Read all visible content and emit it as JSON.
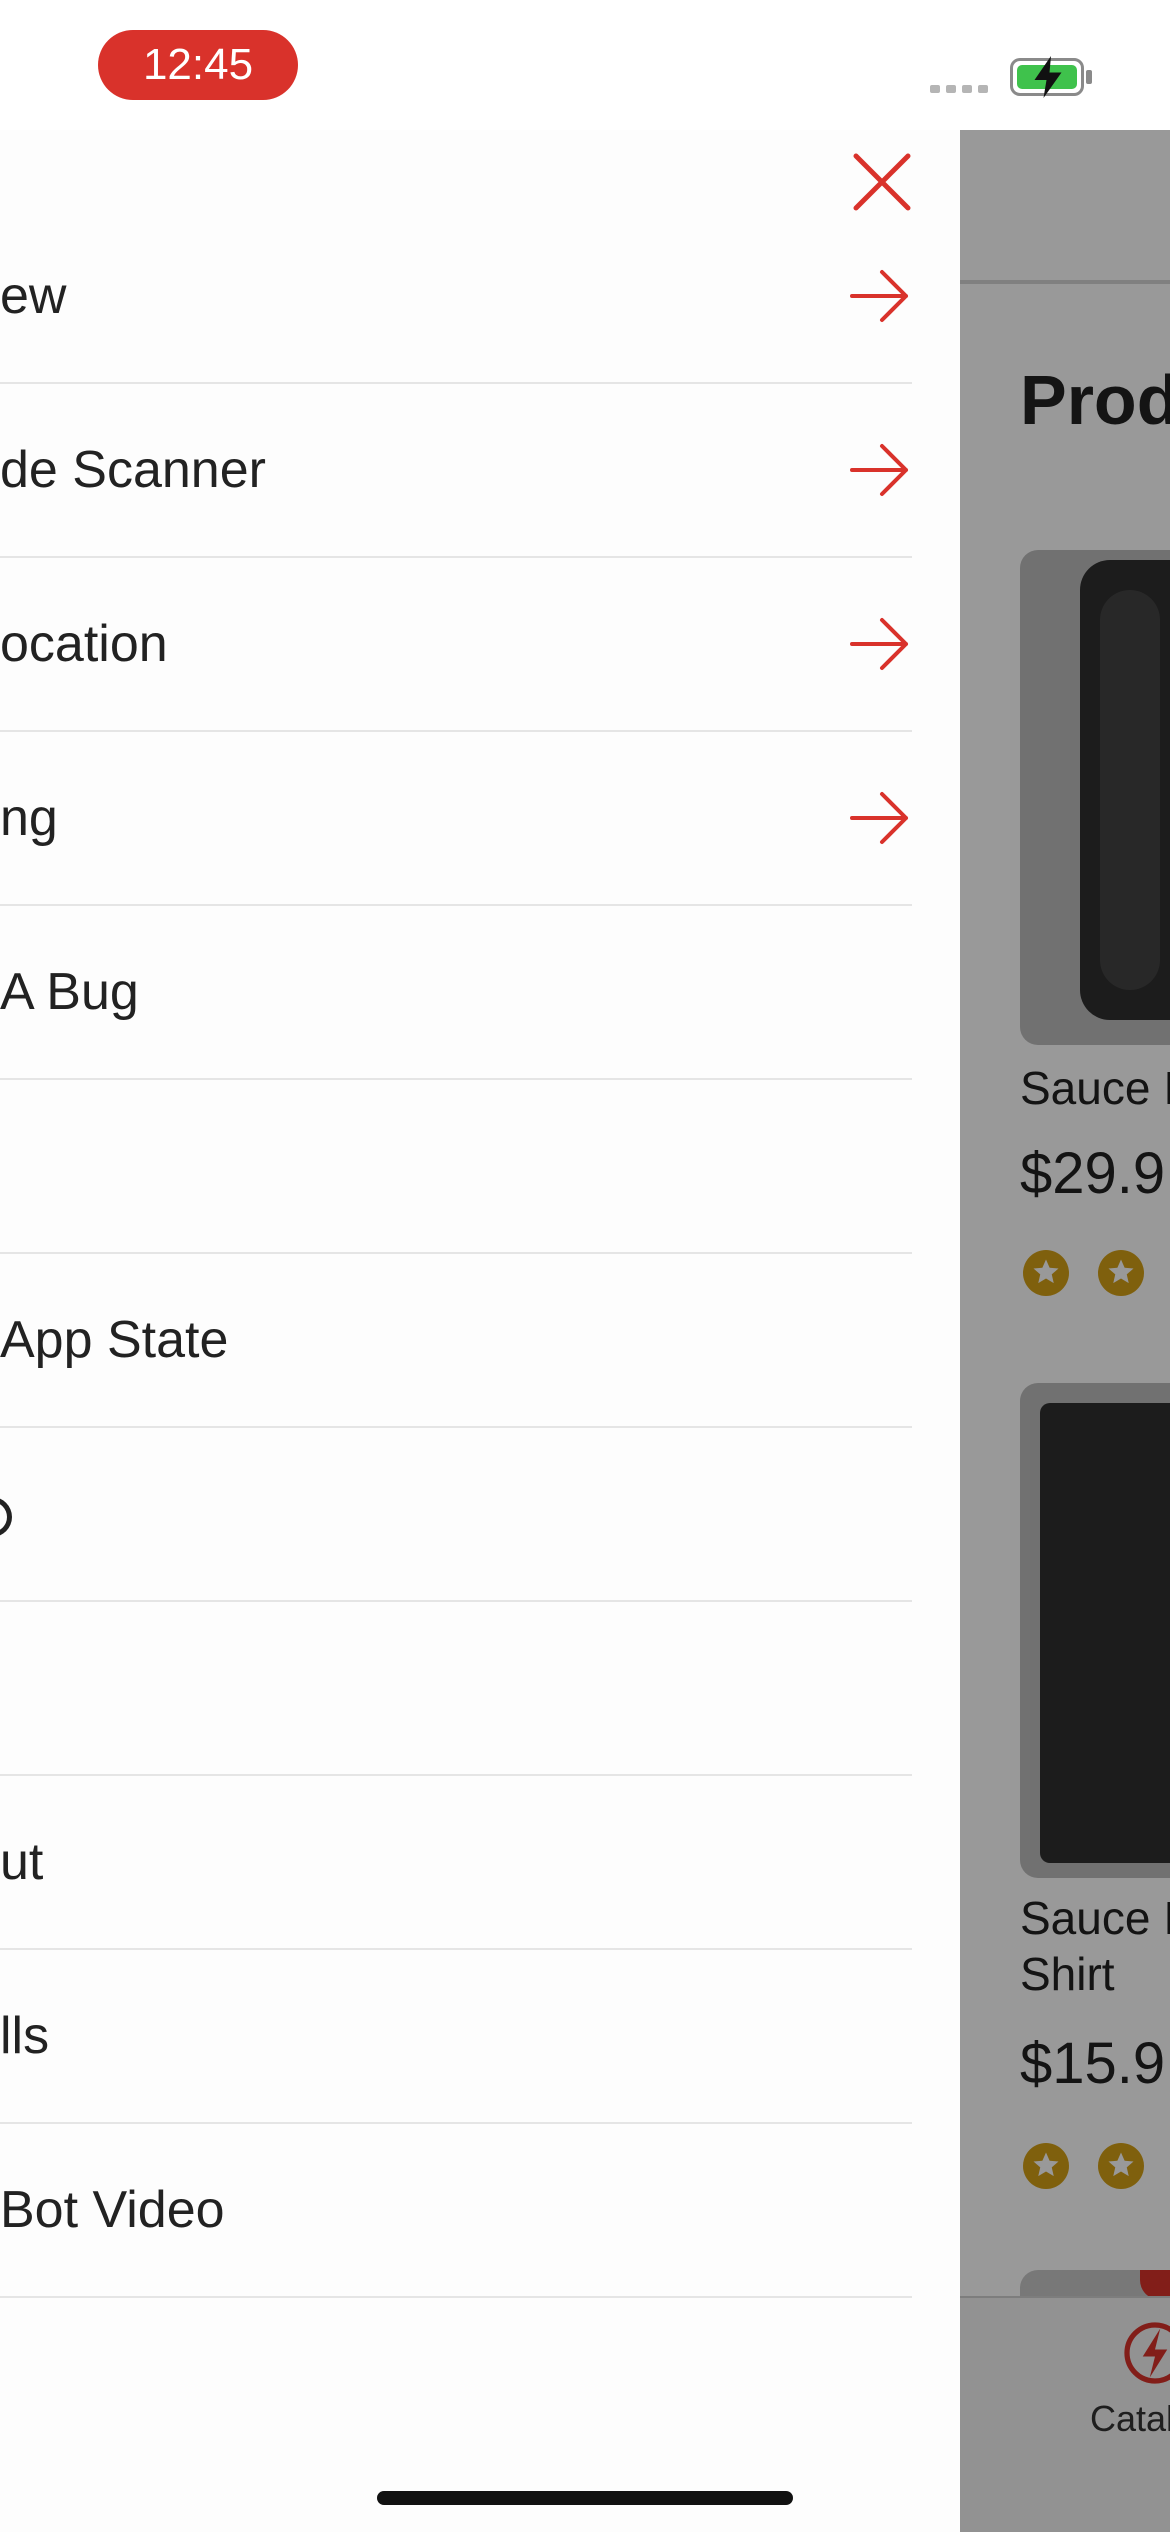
{
  "status_bar": {
    "time": "12:45"
  },
  "drawer": {
    "close_icon": "close-icon",
    "items": [
      {
        "label": "ew",
        "arrow": true
      },
      {
        "label": "de Scanner",
        "arrow": true
      },
      {
        "label": "ocation",
        "arrow": true
      },
      {
        "label": "ng",
        "arrow": true
      },
      {
        "label": " A Bug",
        "arrow": false
      },
      {
        "label": "",
        "arrow": false
      },
      {
        "label": "App State",
        "arrow": false
      },
      {
        "label": "",
        "arrow": false
      },
      {
        "label": "",
        "arrow": false
      },
      {
        "label": "ut",
        "arrow": false
      },
      {
        "label": "lls",
        "arrow": false
      },
      {
        "label": "Bot Video",
        "arrow": false
      }
    ]
  },
  "background": {
    "title": "Prod",
    "products": [
      {
        "name_lines": [
          "Sauce I"
        ],
        "price": "$29.9",
        "stars_visible": 2
      },
      {
        "name_lines": [
          "Sauce I",
          "Shirt"
        ],
        "price": "$15.9",
        "stars_visible": 2
      }
    ],
    "tab": {
      "label": "Catal",
      "icon": "catalog-logo-icon"
    }
  },
  "colors": {
    "accent_red": "#d9322b",
    "star_gold": "#d4a017",
    "battery_green": "#3fc24c"
  }
}
